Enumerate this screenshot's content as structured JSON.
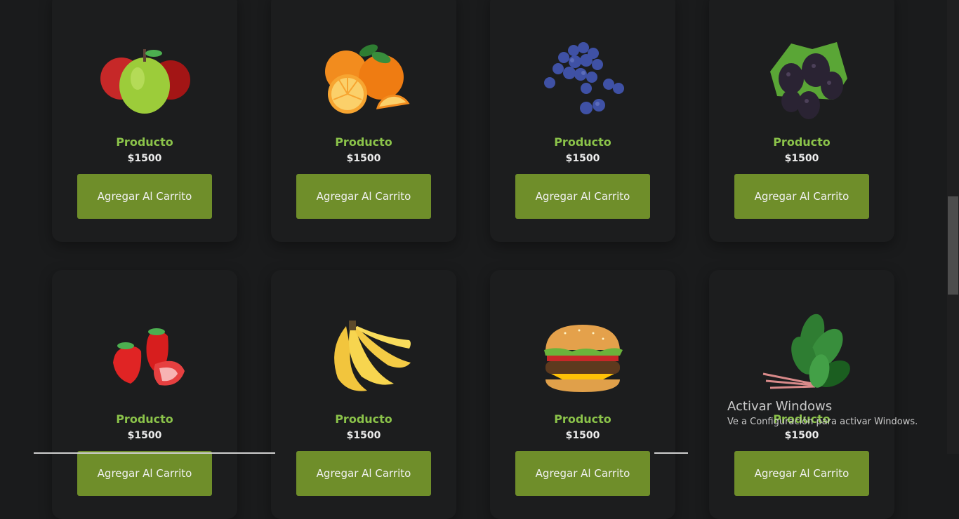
{
  "products": [
    {
      "name": "Producto",
      "price": "$1500",
      "button": "Agregar Al Carrito",
      "image": "apple-image"
    },
    {
      "name": "Producto",
      "price": "$1500",
      "button": "Agregar Al Carrito",
      "image": "orange-image"
    },
    {
      "name": "Producto",
      "price": "$1500",
      "button": "Agregar Al Carrito",
      "image": "blueberry-image"
    },
    {
      "name": "Producto",
      "price": "$1500",
      "button": "Agregar Al Carrito",
      "image": "blackberry-image"
    },
    {
      "name": "Producto",
      "price": "$1500",
      "button": "Agregar Al Carrito",
      "image": "strawberry-image"
    },
    {
      "name": "Producto",
      "price": "$1500",
      "button": "Agregar Al Carrito",
      "image": "banana-image"
    },
    {
      "name": "Producto",
      "price": "$1500",
      "button": "Agregar Al Carrito",
      "image": "burger-image"
    },
    {
      "name": "Producto",
      "price": "$1500",
      "button": "Agregar Al Carrito",
      "image": "spinach-image"
    }
  ],
  "watermark": {
    "title": "Activar Windows",
    "subtitle": "Ve a Configuración para activar Windows."
  },
  "colors": {
    "accent": "#8bc34a",
    "button": "#6f8e2a",
    "background": "#1a1b1c"
  }
}
